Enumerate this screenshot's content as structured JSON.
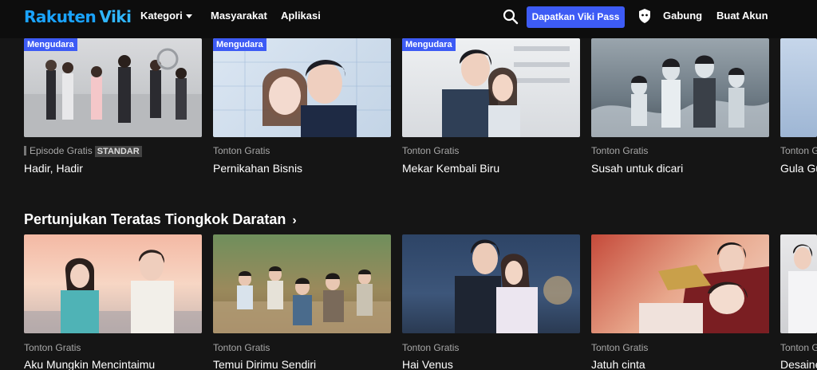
{
  "header": {
    "logo_brand": "Rakuten",
    "logo_product": "Viki",
    "nav": [
      {
        "label": "Kategori"
      },
      {
        "label": "Masyarakat"
      },
      {
        "label": "Aplikasi"
      }
    ],
    "pass_button": "Dapatkan Viki Pass",
    "join": "Gabung",
    "create_account": "Buat Akun"
  },
  "row1": {
    "cards": [
      {
        "badge": "Mengudara",
        "meta": "Episode Gratis",
        "tag": "STANDAR",
        "title": "Hadir, Hadir"
      },
      {
        "badge": "Mengudara",
        "meta": "Tonton Gratis",
        "title": "Pernikahan Bisnis"
      },
      {
        "badge": "Mengudara",
        "meta": "Tonton Gratis",
        "title": "Mekar Kembali Biru"
      },
      {
        "meta": "Tonton Gratis",
        "title": "Susah untuk dicari"
      },
      {
        "meta": "Tonton G",
        "title": "Gula Gu"
      }
    ]
  },
  "section": {
    "title": "Pertunjukan Teratas Tiongkok Daratan",
    "chevron": "›"
  },
  "row2": {
    "cards": [
      {
        "meta": "Tonton Gratis",
        "title": "Aku Mungkin Mencintaimu"
      },
      {
        "meta": "Tonton Gratis",
        "title": "Temui Dirimu Sendiri"
      },
      {
        "meta": "Tonton Gratis",
        "title": "Hai Venus"
      },
      {
        "meta": "Tonton Gratis",
        "title": "Jatuh cinta"
      },
      {
        "meta": "Tonton G",
        "title": "Desaine"
      }
    ]
  },
  "colors": {
    "accent": "#3d5bf5",
    "logo": "#1aa3ff",
    "background": "#151515"
  }
}
